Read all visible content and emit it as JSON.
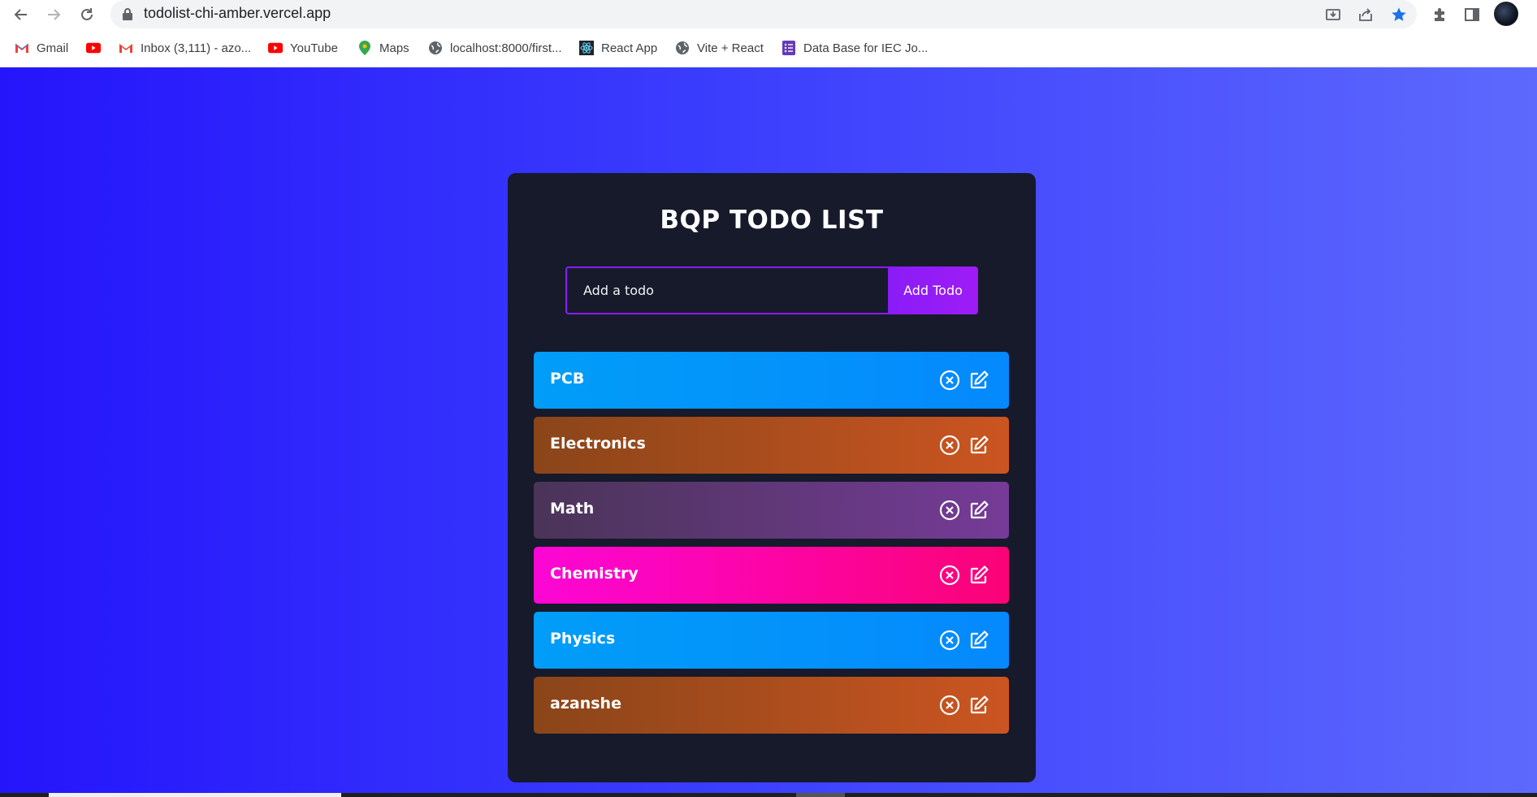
{
  "browser": {
    "url": "todolist-chi-amber.vercel.app",
    "bookmarks": [
      {
        "label": "Gmail",
        "icon": "gmail-icon"
      },
      {
        "label": "",
        "icon": "youtube-icon"
      },
      {
        "label": "Inbox (3,111) - azo...",
        "icon": "gmail-icon"
      },
      {
        "label": "YouTube",
        "icon": "youtube-icon"
      },
      {
        "label": "Maps",
        "icon": "maps-pin-icon"
      },
      {
        "label": "localhost:8000/first...",
        "icon": "globe-icon"
      },
      {
        "label": "React App",
        "icon": "react-icon"
      },
      {
        "label": "Vite + React",
        "icon": "globe-icon"
      },
      {
        "label": "Data Base for IEC Jo...",
        "icon": "forms-icon"
      }
    ]
  },
  "app": {
    "title": "BQP TODO LIST",
    "input_placeholder": "Add a todo",
    "add_button": "Add Todo",
    "todos": [
      {
        "text": "PCB",
        "color": "#019df8"
      },
      {
        "text": "Electronics",
        "color": "#b04d1e"
      },
      {
        "text": "Math",
        "color": "#5e3878"
      },
      {
        "text": "Chemistry",
        "color": "#fb05a8"
      },
      {
        "text": "Physics",
        "color": "#019df8"
      },
      {
        "text": "azanshe",
        "color": "#b04d1e"
      }
    ]
  },
  "colors": {
    "page_gradient_start": "#2515fb",
    "page_gradient_end": "#5d69fd",
    "card_bg": "#161a2b",
    "accent": "#8b1cf7"
  }
}
